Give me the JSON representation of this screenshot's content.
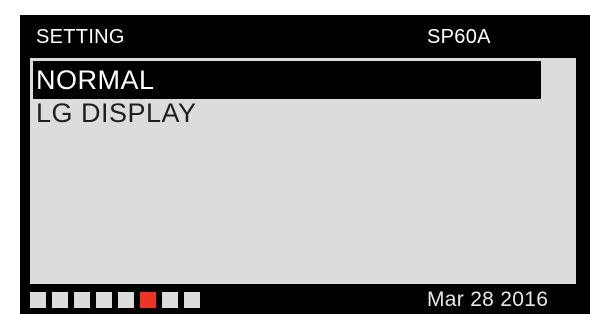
{
  "header": {
    "title": "SETTING",
    "model": "SP60A"
  },
  "menu": {
    "items": [
      {
        "label": "NORMAL",
        "selected": true
      },
      {
        "label": "LG DISPLAY",
        "selected": false
      }
    ]
  },
  "page_indicator": {
    "total": 8,
    "active_index": 5,
    "active_color": "#ee3322",
    "inactive_color": "#dcdcdc"
  },
  "footer": {
    "date": "Mar 28 2016"
  }
}
